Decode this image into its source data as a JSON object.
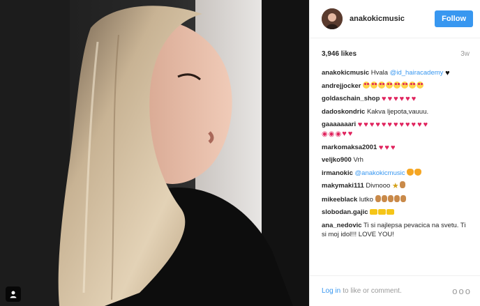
{
  "header": {
    "username": "anakokicmusic",
    "follow_label": "Follow"
  },
  "stats": {
    "likes": "3,946 likes",
    "ago": "3w"
  },
  "comments": [
    {
      "user": "anakokicmusic",
      "text": "Hvala",
      "mention": "@id_hairacademy",
      "emoji": [
        "black-heart"
      ]
    },
    {
      "user": "andrejjocker",
      "text": "",
      "emoji": [
        "heart-eyes",
        "heart-eyes",
        "heart-eyes",
        "heart-eyes",
        "heart-eyes",
        "heart-eyes",
        "heart-eyes",
        "heart-eyes"
      ]
    },
    {
      "user": "goldaschain_shop",
      "text": "",
      "emoji": [
        "heart",
        "heart",
        "heart",
        "heart",
        "heart",
        "heart"
      ]
    },
    {
      "user": "dadoskondric",
      "text": "Kakva ljepota,vauuu.",
      "emoji": []
    },
    {
      "user": "gaaaaaaari",
      "text": "",
      "emoji": [
        "heart",
        "heart",
        "heart",
        "heart",
        "heart",
        "heart",
        "heart",
        "heart",
        "heart",
        "heart",
        "heart",
        "heart"
      ],
      "emoji2": [
        "kiss-lips",
        "kiss-lips",
        "kiss-lips",
        "heart",
        "heart"
      ]
    },
    {
      "user": "markomaksa2001",
      "text": "",
      "emoji": [
        "heart",
        "heart",
        "heart"
      ]
    },
    {
      "user": "veljko900",
      "text": "Vrh",
      "emoji": []
    },
    {
      "user": "irmanokic",
      "text": "",
      "mention": "@anakokicmusic",
      "emoji": [
        "cat",
        "cat"
      ]
    },
    {
      "user": "makymaki111",
      "text": "Divnooo",
      "emoji": [
        "star",
        "hand"
      ]
    },
    {
      "user": "mikeeblack",
      "text": "lutko",
      "emoji": [
        "muscle",
        "hand",
        "hand",
        "hand",
        "hand"
      ]
    },
    {
      "user": "slobodan.gajic",
      "text": "",
      "emoji": [
        "crown",
        "crown",
        "crown"
      ]
    },
    {
      "user": "ana_nedovic",
      "text": "Ti si najlepsa pevacica na svetu. Ti si moj idol!!! LOVE YOU!",
      "emoji": []
    }
  ],
  "footer": {
    "login": "Log in",
    "rest": "to like or comment.",
    "more": "ooo"
  },
  "icons": {
    "tag": "person-tag-icon",
    "more": "more-options-icon"
  },
  "colors": {
    "accent": "#3897f0",
    "heart": "#e0245e"
  }
}
